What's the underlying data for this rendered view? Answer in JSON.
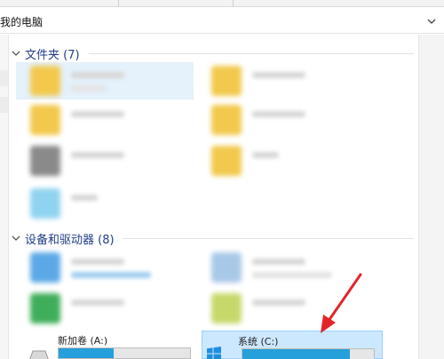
{
  "address_bar": {
    "path_text": "我的电脑"
  },
  "sections": {
    "folders": {
      "title": "文件夹 (7)"
    },
    "devices": {
      "title": "设备和驱动器 (8)"
    }
  },
  "drives": [
    {
      "label": "新加卷 (A:)",
      "used_fraction": 0.42,
      "selected": false
    },
    {
      "label": "系统 (C:)",
      "used_fraction": 0.82,
      "selected": true
    }
  ],
  "colors": {
    "section_title": "#1f3c88",
    "selection": "#cce8ff",
    "usage_bar": "#26a0da",
    "arrow": "#e0262b"
  }
}
